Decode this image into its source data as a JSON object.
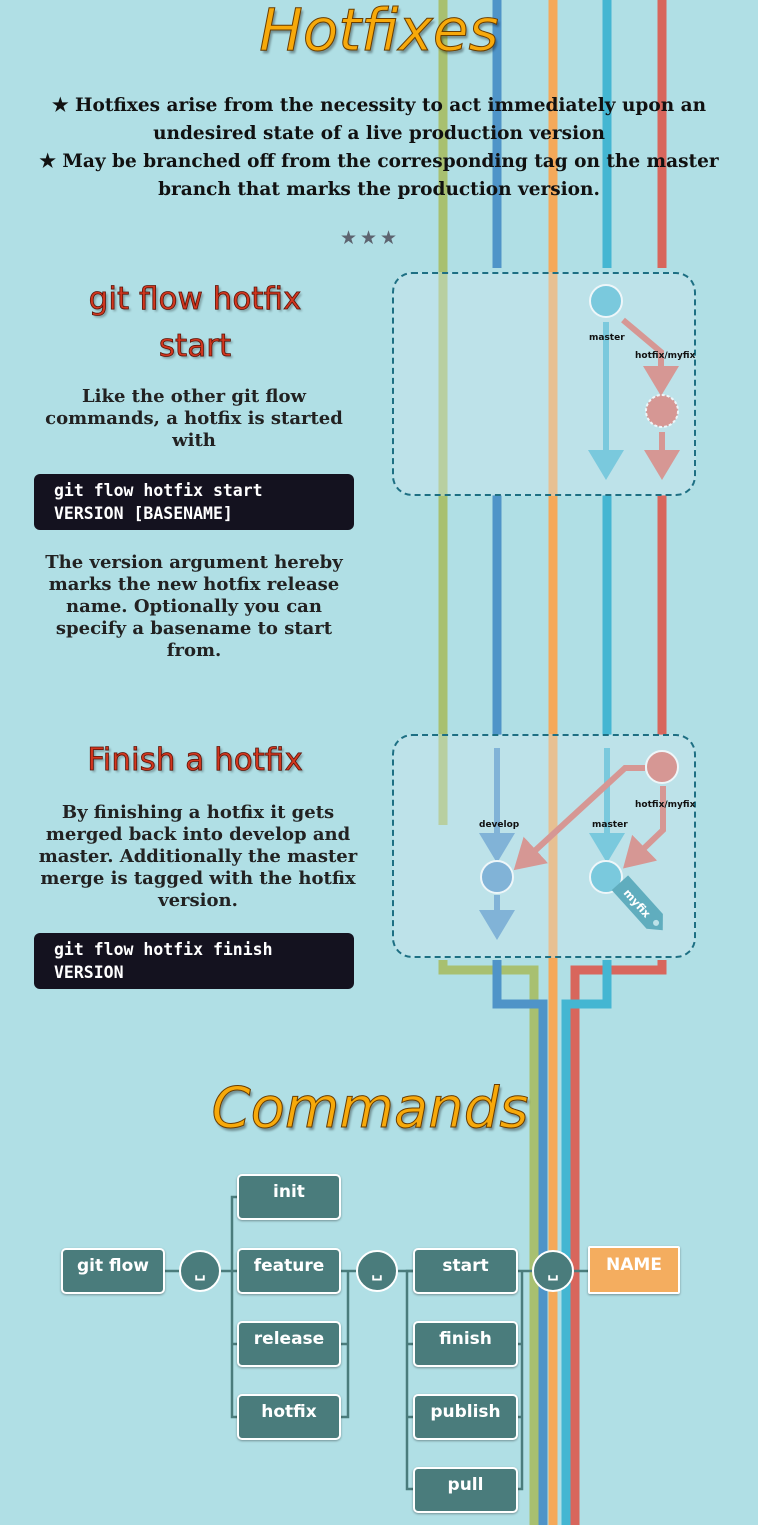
{
  "hotfixes": {
    "title": "Hotfixes",
    "bullet1": "★ Hotfixes arise from the necessity to act immediately upon an undesired state of a live production version",
    "bullet2": "★ May be branched off from the corresponding tag on the master branch that marks the production version.",
    "divider": "★★★"
  },
  "start_section": {
    "heading": "git flow hotfix start",
    "intro": "Like the other git flow commands, a hotfix is started with",
    "code": "git flow hotfix start\nVERSION [BASENAME]",
    "explanation": "The version argument hereby marks the new hotfix release name. Optionally you can specify a basename to start from."
  },
  "diagram_start": {
    "master_label": "master",
    "hotfix_label": "hotfix/myfix"
  },
  "finish_section": {
    "heading": "Finish a hotfix",
    "explanation": "By finishing a hotfix it gets merged back into develop and master. Additionally the master merge is tagged with the hotfix version.",
    "code": "git flow hotfix finish\nVERSION"
  },
  "diagram_finish": {
    "develop_label": "develop",
    "master_label": "master",
    "hotfix_label": "hotfix/myfix",
    "tag_label": "myfix"
  },
  "commands": {
    "title": "Commands",
    "git_flow": "git flow",
    "space_glyph": "␣",
    "subcommands": [
      "init",
      "feature",
      "release",
      "hotfix"
    ],
    "actions": [
      "start",
      "finish",
      "publish",
      "pull"
    ],
    "name_label": "NAME"
  },
  "colors": {
    "background": "#b0dfe5",
    "feature_line": "#a8c070",
    "develop_line": "#4f94c8",
    "release_line": "#f4a95a",
    "master_line": "#44b6d2",
    "hotfix_line": "#d8665c",
    "title_orange": "#f7a90a",
    "heading_red": "#d2371f",
    "command_box": "#4a7c7c",
    "name_box": "#f4ad5f"
  }
}
